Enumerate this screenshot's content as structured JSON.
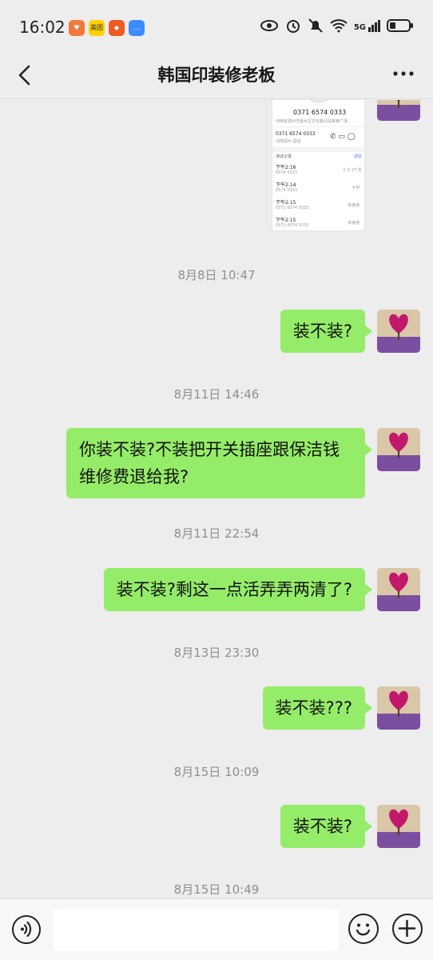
{
  "status_bar": {
    "time": "16:02",
    "network": "5G",
    "app_icons": [
      {
        "name": "heart-app-icon",
        "color": "#f07a3c",
        "text": ""
      },
      {
        "name": "meituan-app-icon",
        "color": "#ffd100",
        "text": "美团"
      },
      {
        "name": "orange-app-icon",
        "color": "#ee5a24",
        "text": ""
      },
      {
        "name": "chat-app-icon",
        "color": "#3d8bff",
        "text": ""
      }
    ]
  },
  "header": {
    "title": "韩国印装修老板"
  },
  "image_message": {
    "phone": "0371 6574 0333",
    "address": "河南省郑州市金水区文化路北段某某广场...",
    "contact_number": "0371 6574 0333",
    "contact_sub": "河南郑州 固话",
    "records_label": "通话记录",
    "records_action": "清空",
    "records": [
      {
        "time": "下午2:16",
        "num": "6574 0333",
        "dur": "3 分 27 秒"
      },
      {
        "time": "下午2:14",
        "num": "6574 0333",
        "dur": "4 秒"
      },
      {
        "time": "下午2:15",
        "num": "0371 6574 0333",
        "dur": "未接通"
      },
      {
        "time": "下午2:15",
        "num": "0371 6574 0333",
        "dur": "未接通"
      }
    ]
  },
  "messages": [
    {
      "timestamp": "8月8日 10:47",
      "text": "装不装?"
    },
    {
      "timestamp": "8月11日 14:46",
      "text": "你装不装?不装把开关插座跟保洁钱维修费退给我?"
    },
    {
      "timestamp": "8月11日 22:54",
      "text": "装不装?剩这一点活弄弄两清了?"
    },
    {
      "timestamp": "8月13日 23:30",
      "text": "装不装???"
    },
    {
      "timestamp": "8月15日 10:09",
      "text": "装不装?"
    },
    {
      "timestamp": "8月15日 10:49",
      "text": ""
    }
  ],
  "input": {
    "placeholder": ""
  },
  "colors": {
    "bubble": "#95ec69",
    "background": "#ededed"
  }
}
